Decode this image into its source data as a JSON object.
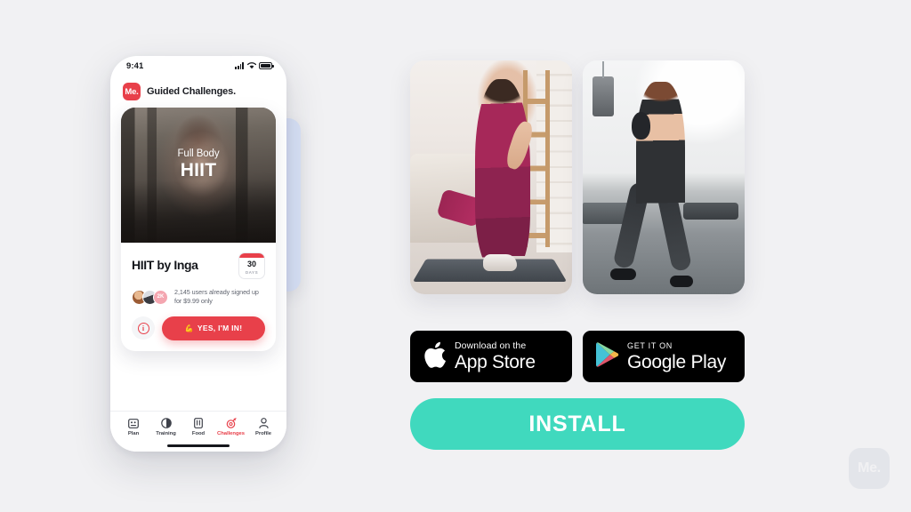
{
  "background_color": "#F1F1F3",
  "brand": {
    "accent_red": "#E8404A",
    "accent_teal": "#40D9BE",
    "logo_text": "Me.",
    "watermark_text": "Me."
  },
  "phone": {
    "status_bar": {
      "time": "9:41",
      "icons": [
        "signal-bars-icon",
        "wifi-icon",
        "battery-icon"
      ]
    },
    "app_header": {
      "logo_text": "Me.",
      "title": "Guided Challenges."
    },
    "challenge_card": {
      "hero": {
        "subtitle": "Full Body",
        "title": "HIIT",
        "photo_description": "woman boxing in a dark gym"
      },
      "title": "HIIT by Inga",
      "days_badge": {
        "number": "30",
        "label": "DAYS"
      },
      "avatars": [
        {
          "name": "avatar-user-1",
          "type": "photo"
        },
        {
          "name": "avatar-user-2",
          "type": "photo"
        },
        {
          "name": "avatar-count",
          "type": "count",
          "label": "2K"
        }
      ],
      "signup_text": "2,145 users already signed up for $9.99 only",
      "info_button": {
        "icon": "info-icon",
        "glyph": "i"
      },
      "cta_button": {
        "emoji": "💪",
        "label": "YES, I'M IN!"
      }
    },
    "tab_bar": {
      "items": [
        {
          "label": "Plan",
          "icon": "plan-icon",
          "active": false
        },
        {
          "label": "Training",
          "icon": "training-icon",
          "active": false
        },
        {
          "label": "Food",
          "icon": "food-icon",
          "active": false
        },
        {
          "label": "Challenges",
          "icon": "challenges-icon",
          "active": true
        },
        {
          "label": "Profile",
          "icon": "profile-icon",
          "active": false
        }
      ]
    }
  },
  "photos": [
    {
      "name": "photo-home-lunge",
      "description": "Woman in magenta workout set doing a lunge in a bright living room"
    },
    {
      "name": "photo-gym-kettlebell",
      "description": "Woman wearing a face mask holding a kettlebell in a gym studio"
    }
  ],
  "store_badges": [
    {
      "name": "app-store-badge",
      "icon": "apple-icon",
      "small_text": "Download on the",
      "big_text": "App Store"
    },
    {
      "name": "google-play-badge",
      "icon": "google-play-icon",
      "small_text": "GET IT ON",
      "big_text": "Google Play"
    }
  ],
  "install_button": {
    "label": "INSTALL"
  }
}
